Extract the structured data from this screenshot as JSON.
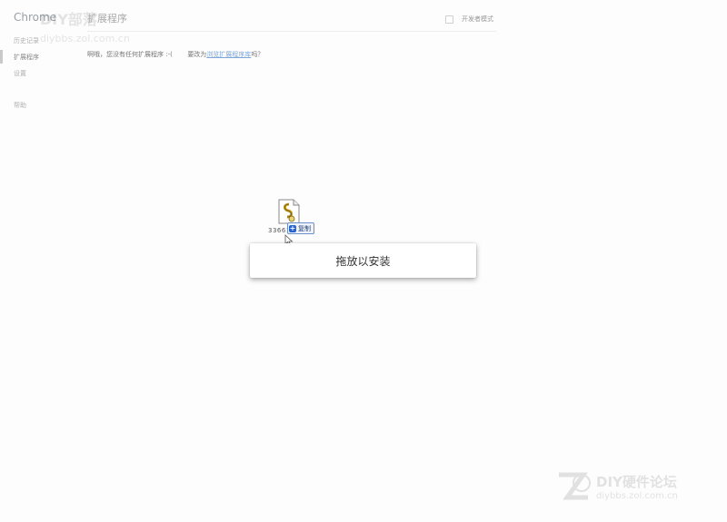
{
  "app": {
    "title": "Chrome"
  },
  "sidebar": {
    "items": [
      {
        "label": "历史记录"
      },
      {
        "label": "扩展程序"
      },
      {
        "label": "设置"
      },
      {
        "label": "帮助"
      }
    ]
  },
  "header": {
    "title": "扩展程序",
    "dev_mode_label": "开发者模式",
    "dev_mode_checked": false
  },
  "main": {
    "empty_message_prefix": "啊哦，您没有任何扩展程序 :-(",
    "empty_message_middle": "要改为",
    "empty_message_link": "浏览扩展程序库",
    "empty_message_suffix": "吗？"
  },
  "drag": {
    "filename": "33661",
    "action_label": "复制"
  },
  "drop_zone": {
    "label": "拖放以安装"
  },
  "watermarks": {
    "top": {
      "brand": "DIY部落",
      "url": "diybbs.zol.com.cn"
    },
    "bottom": {
      "brand": "DIY硬件论坛",
      "url": "diybbs.zol.com.cn"
    }
  }
}
